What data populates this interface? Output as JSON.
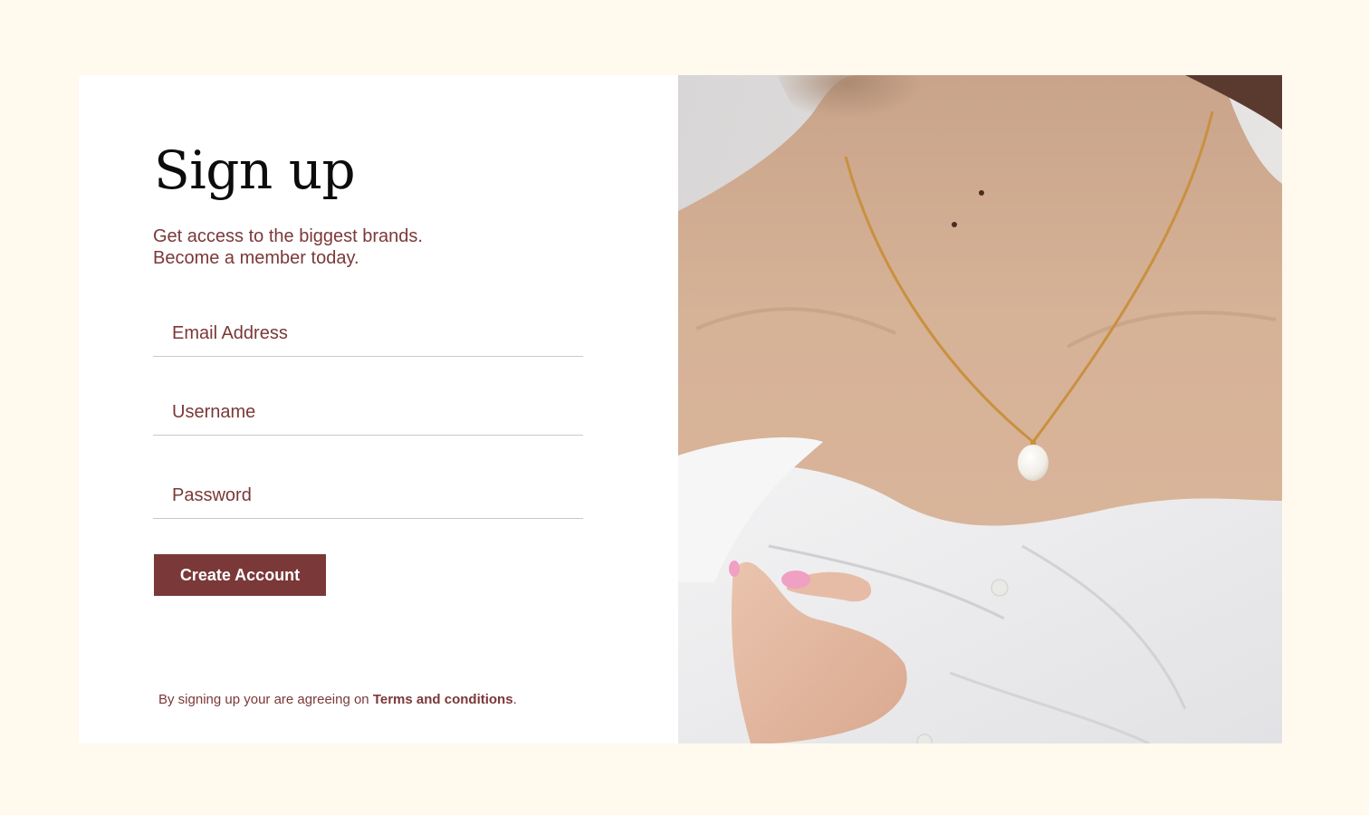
{
  "signup": {
    "title": "Sign up",
    "subtitle_line1": "Get access to the biggest brands.",
    "subtitle_line2": "Become a member today.",
    "email_placeholder": "Email Address",
    "username_placeholder": "Username",
    "password_placeholder": "Password",
    "create_button_label": "Create Account",
    "terms_prefix": "By signing up your are agreeing on ",
    "terms_link": "Terms and conditions",
    "terms_suffix": "."
  },
  "hero_image": {
    "subject": "woman wearing a gold chain necklace with a pearl pendant and an off-shoulder white shirt"
  },
  "colors": {
    "page_background": "#fff9ee",
    "card_background": "#ffffff",
    "accent": "#7b3838",
    "title_text": "#0c0c0c",
    "field_underline": "#c9c9c9",
    "button_text": "#ffffff"
  }
}
